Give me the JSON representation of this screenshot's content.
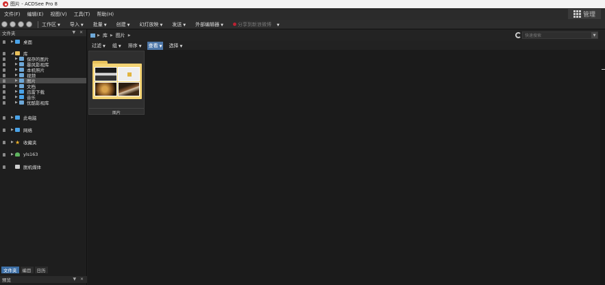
{
  "window": {
    "title": "图片 - ACDSee Pro 8"
  },
  "menubar": {
    "items": [
      "文件(F)",
      "编辑(E)",
      "视图(V)",
      "工具(T)",
      "帮助(H)"
    ],
    "manage_label": "管理"
  },
  "toolbar": {
    "workspace": "工作区",
    "import": "导入",
    "batch": "批量",
    "create": "创建",
    "slideshow": "幻灯放映",
    "send": "发送",
    "external_editor": "外部编辑器",
    "share": "分享到新浪微博"
  },
  "left_pane": {
    "header": "文件夹",
    "tree": [
      {
        "label": "桌面",
        "icon": "desktop-icon",
        "color": "#4aa3e8"
      },
      {
        "label": "库",
        "icon": "library-icon",
        "color": "#e9c05a"
      },
      {
        "label": "保存的图片",
        "icon": "folder-icon",
        "color": "#6ea8d8"
      },
      {
        "label": "暴风影视库",
        "icon": "folder-icon",
        "color": "#6ea8d8"
      },
      {
        "label": "本机照片",
        "icon": "folder-icon",
        "color": "#6ea8d8"
      },
      {
        "label": "视频",
        "icon": "video-icon",
        "color": "#6ea8d8"
      },
      {
        "label": "图片",
        "icon": "pictures-icon",
        "color": "#6ea8d8"
      },
      {
        "label": "文档",
        "icon": "document-icon",
        "color": "#6ea8d8"
      },
      {
        "label": "迅雷下载",
        "icon": "download-icon",
        "color": "#4aa3e8"
      },
      {
        "label": "音乐",
        "icon": "music-icon",
        "color": "#4aa3e8"
      },
      {
        "label": "优酷影视库",
        "icon": "folder-icon",
        "color": "#6ea8d8"
      },
      {
        "label": "此电脑",
        "icon": "computer-icon",
        "color": "#4aa3e8"
      },
      {
        "label": "网络",
        "icon": "network-icon",
        "color": "#4aa3e8"
      },
      {
        "label": "收藏夹",
        "icon": "star-icon",
        "color": "#f0b429"
      },
      {
        "label": "yls163",
        "icon": "user-icon",
        "color": "#5fb35f"
      },
      {
        "label": "脱机媒体",
        "icon": "media-icon",
        "color": "#cfcfcf"
      }
    ],
    "tabs": [
      "文件夹",
      "编目",
      "日历"
    ],
    "preview_header": "预览"
  },
  "address": {
    "segments": [
      "库",
      "图片"
    ],
    "search_placeholder": "快速搜索"
  },
  "filterbar": {
    "filter": "过滤",
    "group": "组",
    "sort": "排序",
    "view": "查看",
    "select": "选择"
  },
  "content": {
    "items": [
      {
        "caption": "图片"
      }
    ]
  },
  "colors": {
    "accent": "#4e77a8",
    "folder": "#f3d374"
  }
}
